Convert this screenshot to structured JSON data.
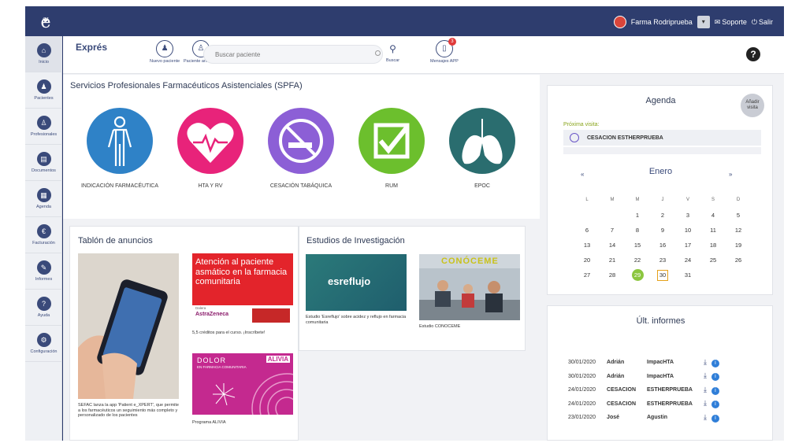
{
  "topbar": {
    "logo_text": "e",
    "user_name": "Farma Rodriprueba",
    "support_label": "Soporte",
    "logout_label": "Salir"
  },
  "sidebar": {
    "items": [
      {
        "label": "Inicio",
        "icon": "home-icon"
      },
      {
        "label": "Pacientes",
        "icon": "patient-icon"
      },
      {
        "label": "Profesionales",
        "icon": "professional-icon"
      },
      {
        "label": "Documentos",
        "icon": "document-icon"
      },
      {
        "label": "Agenda",
        "icon": "calendar-icon"
      },
      {
        "label": "Facturación",
        "icon": "euro-icon"
      },
      {
        "label": "Informes",
        "icon": "edit-icon"
      },
      {
        "label": "Ayuda",
        "icon": "help-icon"
      },
      {
        "label": "Configuración",
        "icon": "gear-icon"
      }
    ]
  },
  "express": {
    "title": "Exprés",
    "new_patient": "Nuevo paciente",
    "anon_patient": "Paciente anónimo",
    "search_placeholder": "Buscar paciente",
    "search_label": "Buscar",
    "messages_label": "Mensajes APP",
    "messages_count": "3",
    "help_glyph": "?"
  },
  "spfa": {
    "title": "Servicios Profesionales Farmacéuticos Asistenciales (SPFA)",
    "services": [
      {
        "label": "INDICACIÓN FARMACÉUTICA",
        "color": "#2f82c7"
      },
      {
        "label": "HTA Y RV",
        "color": "#e8237a"
      },
      {
        "label": "CESACIÓN TABÁQUICA",
        "color": "#8c5fd6"
      },
      {
        "label": "RUM",
        "color": "#6cbf2d"
      },
      {
        "label": "EPOC",
        "color": "#2a6d6f"
      }
    ]
  },
  "tablon": {
    "title": "Tablón de anuncios",
    "phone_caption": "SEFAC lanza la app 'Patient e_XPERT', que permite a los farmacéuticos un seguimiento más completo y personalizado de los pacientes",
    "asma_text": "Atención al paciente asmático en la farmacia comunitaria",
    "asma_brand_small": "Dalera",
    "asma_brand": "AstraZeneca",
    "asma_caption": "5,5 créditos para el curso. ¡Inscríbete!",
    "dolor_title": "DOLOR",
    "dolor_sub": "EN FARMACIA COMUNITARIA",
    "dolor_brand": "ALIVIA",
    "dolor_caption": "Programa ALIVIA"
  },
  "estudios": {
    "title": "Estudios de Investigación",
    "esreflujo_logo": "esreflujo",
    "esreflujo_caption": "Estudio 'Esreflujo' sobre acidez y reflujo en farmacia comunitaria",
    "conoceme_logo": "CONÓCEME",
    "conoceme_caption": "Estudio CONOCEME"
  },
  "agenda": {
    "title": "Agenda",
    "add_visit": "Añadir visita",
    "next_visit_label": "Próxima visita:",
    "next_visit_name": "CESACION ESTHERPRUEBA",
    "month": "Enero",
    "prev": "«",
    "next": "»",
    "weekdays": [
      "L",
      "M",
      "M",
      "J",
      "V",
      "S",
      "D"
    ],
    "days": [
      "",
      "",
      "1",
      "2",
      "3",
      "4",
      "5",
      "6",
      "7",
      "8",
      "9",
      "10",
      "11",
      "12",
      "13",
      "14",
      "15",
      "16",
      "17",
      "18",
      "19",
      "20",
      "21",
      "22",
      "23",
      "24",
      "25",
      "26",
      "27",
      "28",
      "29",
      "30",
      "31",
      "",
      ""
    ],
    "today": "29",
    "selected": "30"
  },
  "informes": {
    "title": "Últ. informes",
    "rows": [
      {
        "date": "30/01/2020",
        "name": "Adrián",
        "service": "ImpacHTA"
      },
      {
        "date": "30/01/2020",
        "name": "Adrián",
        "service": "ImpacHTA"
      },
      {
        "date": "24/01/2020",
        "name": "CESACION",
        "service": "ESTHERPRUEBA"
      },
      {
        "date": "24/01/2020",
        "name": "CESACION",
        "service": "ESTHERPRUEBA"
      },
      {
        "date": "23/01/2020",
        "name": "José",
        "service": "Agustin"
      }
    ]
  }
}
